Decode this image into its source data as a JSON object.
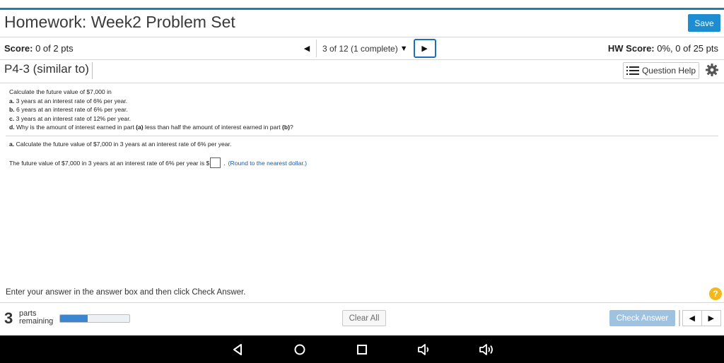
{
  "header": {
    "title": "Homework: Week2 Problem Set",
    "save_label": "Save"
  },
  "score_bar": {
    "score_label": "Score:",
    "score_value": "0 of 2 pts",
    "nav_status": "3 of 12 (1 complete)",
    "hw_score_label": "HW Score:",
    "hw_score_value": "0%, 0 of 25 pts"
  },
  "question": {
    "id": "P4-3 (similar to)",
    "help_label": "Question Help"
  },
  "problem": {
    "intro": "Calculate the future value of $7,000 in",
    "items": [
      {
        "letter": "a.",
        "text": "3 years at an interest rate of 6% per year."
      },
      {
        "letter": "b.",
        "text": "6 years at an interest rate of 6% per year."
      },
      {
        "letter": "c.",
        "text": "3 years at an interest rate of 12% per year."
      },
      {
        "letter": "d.",
        "text_before": "Why is the amount of interest earned in part ",
        "ref1": "(a)",
        "text_mid": " less than half the amount of interest earned in part ",
        "ref2": "(b)",
        "text_after": "?"
      }
    ]
  },
  "part_a": {
    "letter": "a.",
    "prompt": "Calculate the future value of $7,000 in 3 years at an interest rate of 6% per year.",
    "answer_prefix": "The future value of $7,000 in 3 years at an interest rate of 6% per year is $",
    "answer_value": "",
    "answer_suffix": ".",
    "round_note": "(Round to the nearest dollar.)"
  },
  "footer": {
    "instruction": "Enter your answer in the answer box and then click Check Answer.",
    "help_symbol": "?",
    "parts_count": "3",
    "parts_line1": "parts",
    "parts_line2": "remaining",
    "progress_fraction": 0.4,
    "clear_all_label": "Clear All",
    "check_answer_label": "Check Answer"
  },
  "colors": {
    "accent": "#1e8cd1",
    "top_rule": "#1f7fa8",
    "check_disabled": "#9fc2e0",
    "help_badge": "#f2b81c"
  },
  "icons": {
    "nav_prev": "triangle-left-icon",
    "nav_next": "triangle-right-icon",
    "dropdown": "caret-down-icon",
    "question_help": "list-icon",
    "settings": "gear-icon",
    "android": [
      "back-icon",
      "home-icon",
      "recents-icon",
      "volume-down-icon",
      "volume-up-icon"
    ]
  }
}
